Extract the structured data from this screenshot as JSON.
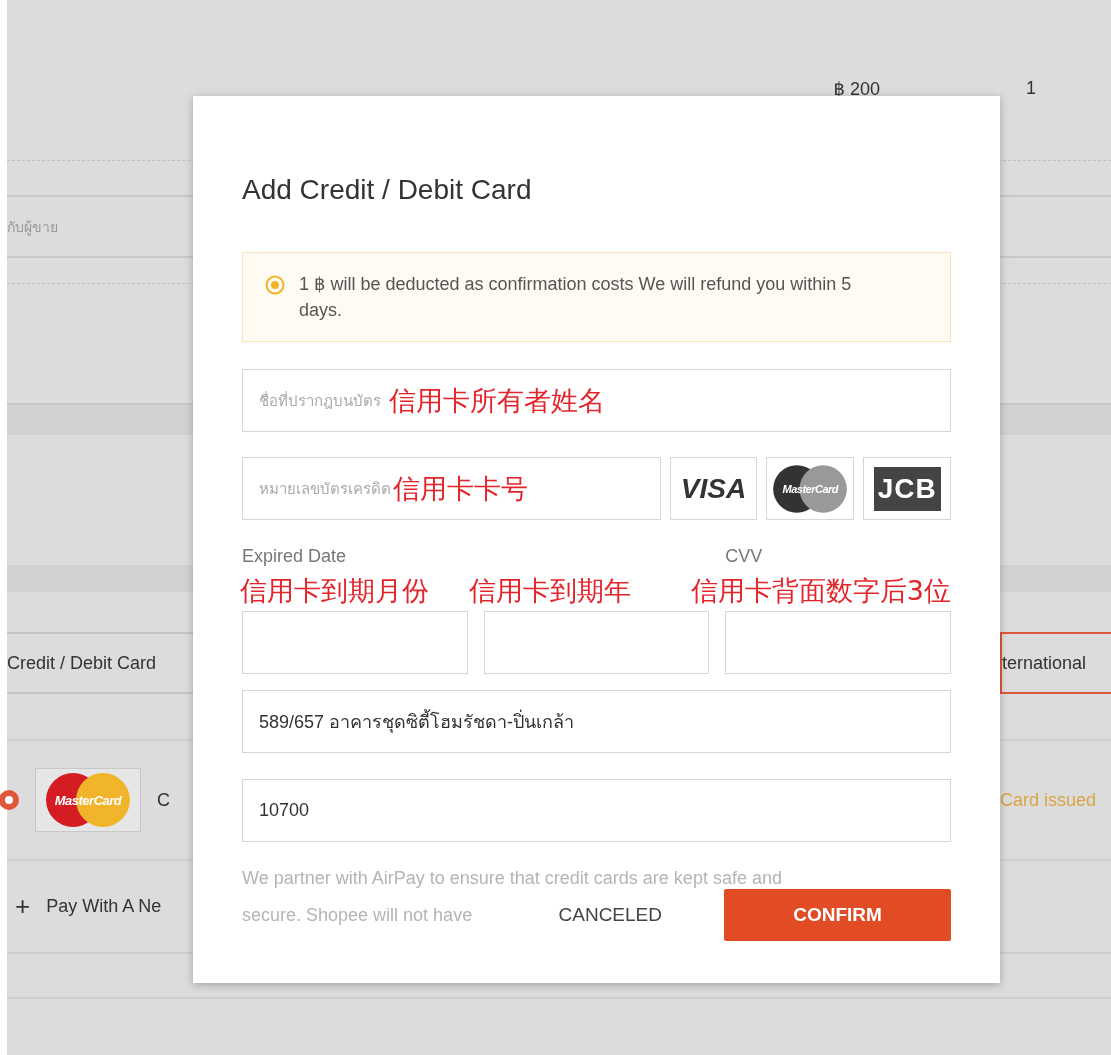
{
  "background": {
    "price": "฿ 200",
    "quantity": "1",
    "seller_note": "กับผู้ขาย",
    "payment_tabs": [
      {
        "label": "Credit / Debit Card",
        "selected": false
      },
      {
        "label": "ternational",
        "selected": true
      }
    ],
    "saved_card": {
      "selected": true,
      "brand": "MasterCard",
      "label": "C",
      "note": "Card issued"
    },
    "add_card": {
      "icon": "+",
      "label": "Pay With A Ne"
    }
  },
  "dialog": {
    "title": "Add Credit / Debit Card",
    "notice": "1 ฿ will be deducted as confirmation costs We will refund you within 5 days.",
    "name_field": {
      "placeholder": "ชื่อที่ปรากฎบนบัตร",
      "annotation": "信用卡所有者姓名"
    },
    "card_number_field": {
      "placeholder": "หมายเลขบัตรเครดิต",
      "annotation": "信用卡卡号"
    },
    "card_brands": [
      {
        "kind": "visa",
        "label": "VISA"
      },
      {
        "kind": "mastercard",
        "label": "MasterCard"
      },
      {
        "kind": "jcb",
        "label": "JCB"
      }
    ],
    "expiry_label": "Expired Date",
    "cvv_label": "CVV",
    "small_fields": [
      {
        "annotation": "信用卡到期月份"
      },
      {
        "annotation": "信用卡到期年"
      },
      {
        "annotation": "信用卡背面数字后3位"
      }
    ],
    "address": "589/657 อาคารชุดซิตี้โฮมรัชดา-ปิ่นเกล้า",
    "postal_code": "10700",
    "partner_note": [
      "We partner with AirPay to ensure that credit cards are kept safe and",
      "secure. Shopee will not have"
    ],
    "buttons": {
      "cancel": "CANCELED",
      "confirm": "CONFIRM"
    }
  }
}
